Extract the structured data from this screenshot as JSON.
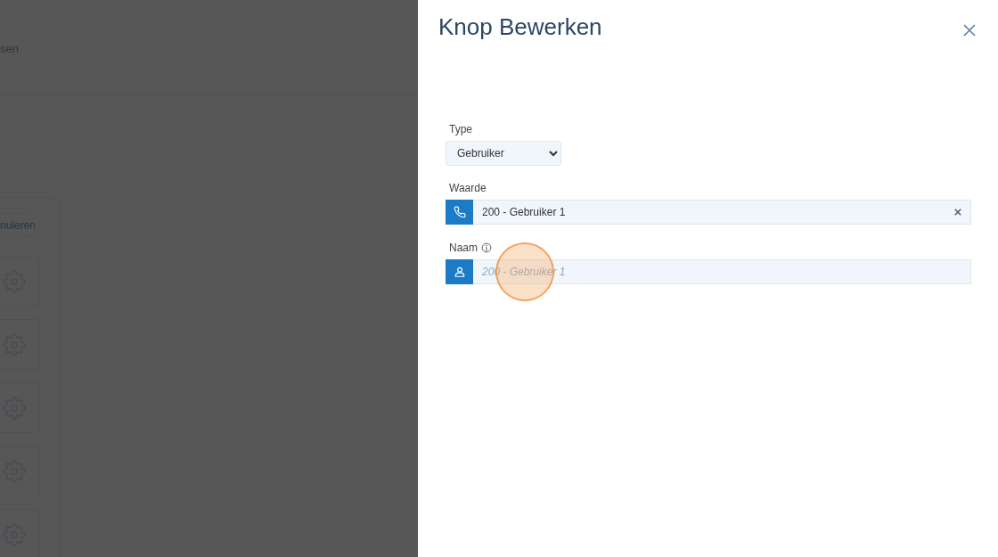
{
  "background_page": {
    "breadcrumb": "sen",
    "cancel_button": "nuleren",
    "tiles": [
      {
        "kind": "settings"
      },
      {
        "kind": "settings"
      },
      {
        "kind": "settings"
      },
      {
        "kind": "settings"
      },
      {
        "kind": "settings"
      }
    ]
  },
  "panel": {
    "title": "Knop Bewerken",
    "type_field": {
      "label": "Type",
      "value": "Gebruiker"
    },
    "value_field": {
      "label": "Waarde",
      "value": "200 - Gebruiker 1"
    },
    "name_field": {
      "label": "Naam",
      "placeholder": "200 - Gebruiker 1"
    }
  }
}
